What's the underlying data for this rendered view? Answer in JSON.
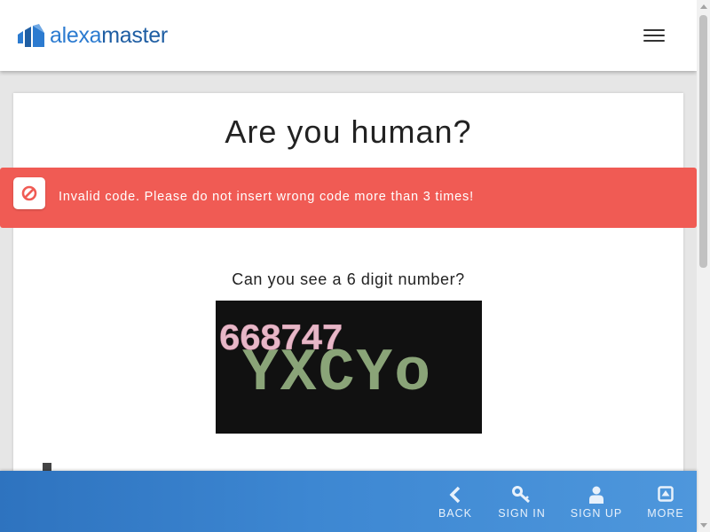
{
  "header": {
    "logo_part1": "alexa",
    "logo_part2": "master",
    "menu_icon": "hamburger-icon"
  },
  "colors": {
    "brand_light": "#2c7bd0",
    "brand_dark": "#1f5ea3",
    "alert_bg": "#f05b54",
    "captcha_digits": "#e7b7c7",
    "captcha_noise": "#8aa478"
  },
  "main": {
    "title": "Are you human?",
    "alert": {
      "icon": "ban-icon",
      "message": "Invalid code. Please do not insert wrong code more than 3 times!"
    },
    "question": "Can you see a 6 digit number?",
    "captcha": {
      "digits": "668747",
      "noise": "YXCYo"
    }
  },
  "bottom_nav": [
    {
      "label": "BACK",
      "icon": "chevron-left-icon"
    },
    {
      "label": "SIGN IN",
      "icon": "key-icon"
    },
    {
      "label": "SIGN UP",
      "icon": "user-icon"
    },
    {
      "label": "MORE",
      "icon": "caret-up-square-icon"
    }
  ]
}
